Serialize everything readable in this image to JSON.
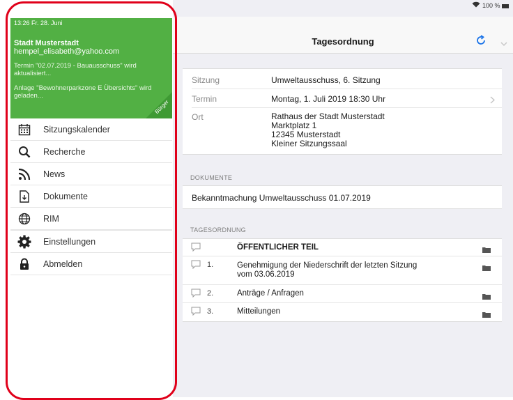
{
  "sidebar": {
    "status_time": "13:26  Fr. 28. Juni",
    "account_name": "Stadt Musterstadt",
    "account_email": "hempel_elisabeth@yahoo.com",
    "messages": [
      "Termin \"02.07.2019 - Bauausschuss\" wird aktualisiert...",
      "Anlage \"Bewohnerparkzone E Übersichts\" wird geladen..."
    ],
    "corner_label": "Bürger",
    "accent_color": "#52b044",
    "items": [
      {
        "label": "Sitzungskalender",
        "icon": "calendar-icon"
      },
      {
        "label": "Recherche",
        "icon": "search-icon"
      },
      {
        "label": "News",
        "icon": "rss-icon"
      },
      {
        "label": "Dokumente",
        "icon": "document-icon"
      },
      {
        "label": "RIM",
        "icon": "globe-icon"
      },
      {
        "label": "Einstellungen",
        "icon": "gear-icon"
      },
      {
        "label": "Abmelden",
        "icon": "lock-icon"
      }
    ]
  },
  "topbar": {
    "title": "Tagesordnung",
    "device_status": "100 %"
  },
  "meeting": {
    "sitzung_label": "Sitzung",
    "sitzung_value": "Umweltausschuss, 6. Sitzung",
    "termin_label": "Termin",
    "termin_value": "Montag, 1. Juli 2019 18:30 Uhr",
    "ort_label": "Ort",
    "ort_lines": [
      "Rathaus der Stadt Musterstadt",
      "Marktplatz 1",
      "12345 Musterstadt",
      "Kleiner Sitzungssaal"
    ]
  },
  "documents": {
    "section_title": "DOKUMENTE",
    "items": [
      "Bekanntmachung Umweltausschuss 01.07.2019"
    ]
  },
  "agenda": {
    "section_title": "TAGESORDNUNG",
    "items": [
      {
        "number": "",
        "text": "ÖFFENTLICHER TEIL",
        "bold": true
      },
      {
        "number": "1.",
        "text": "Genehmigung der Niederschrift der letzten Sitzung vom 03.06.2019"
      },
      {
        "number": "2.",
        "text": "Anträge / Anfragen"
      },
      {
        "number": "3.",
        "text": "Mitteilungen"
      }
    ]
  },
  "colors": {
    "highlight": "#e0001a",
    "ios_blue": "#1a73e8"
  }
}
